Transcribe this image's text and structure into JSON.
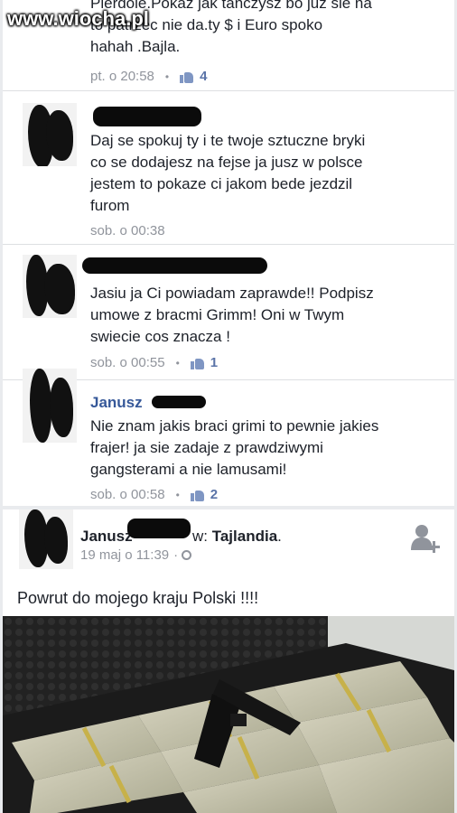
{
  "watermark": "www.wiocha.pl",
  "comments": [
    {
      "text": "Pierdole.Pokaz jak tanczysz bo juz sie na\nto patrzec nie da.ty $ i Euro spoko\nhahah .Bajla.",
      "time": "pt. o 20:58",
      "likes": "4"
    },
    {
      "text": "Daj se spokuj ty i te twoje sztuczne bryki\nco se dodajesz na fejse ja jusz w polsce\njestem to pokaze ci jakom bede jezdzil\nfurom",
      "time": "sob. o 00:38"
    },
    {
      "text": "Jasiu ja Ci powiadam zaprawde!! Podpisz\numowe z bracmi Grimm! Oni w Twym\nswiecie cos znacza !",
      "time": "sob. o 00:55",
      "likes": "1"
    },
    {
      "author": "Janusz",
      "text": "Nie znam jakis braci grimi to pewnie jakies\nfrajer! ja sie zadaje z prawdziwymi\ngangsterami a nie lamusami!",
      "time": "sob. o 00:58",
      "likes": "2"
    }
  ],
  "post": {
    "author": "Janusz",
    "with_prefix": "w:",
    "place": "Tajlandia",
    "place_suffix": ".",
    "time": "19 maj o 11:39",
    "sep": "·",
    "text": "Powrut do mojego kraju Polski !!!!"
  },
  "ui": {
    "dot": "•"
  },
  "colors": {
    "link": "#365899",
    "meta": "#90949c",
    "like": "#5b74a8",
    "background": "#e9ebee"
  },
  "icons": [
    "like-icon",
    "globe-icon",
    "add-friend-icon",
    "gun-icon"
  ]
}
